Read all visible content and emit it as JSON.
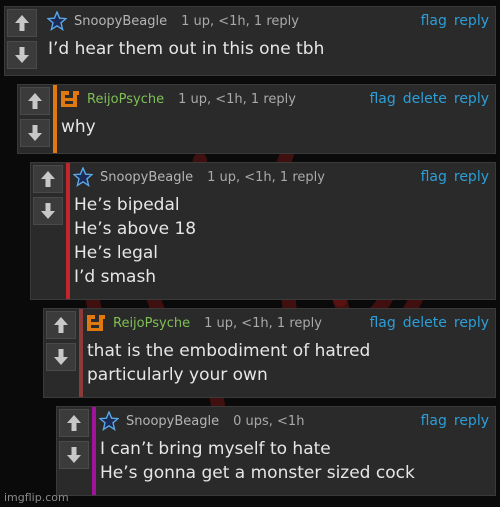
{
  "colors": {
    "link": "#2b9fd8",
    "sigil": "#7a1616",
    "accent_orange": "#e07a10",
    "accent_red": "#c0262c",
    "accent_dark_red": "#8c3a3a",
    "accent_magenta": "#a0149a"
  },
  "comments": [
    {
      "username": "SnoopyBeagle",
      "avatar_icon": "star-icon",
      "meta": "1 up, <1h, 1 reply",
      "actions": [
        "flag",
        "reply"
      ],
      "lines": [
        "I’d hear them out in this one tbh"
      ]
    },
    {
      "username": "ReijoPsyche",
      "avatar_icon": "pixel-logo-icon",
      "meta": "1 up, <1h, 1 reply",
      "actions": [
        "flag",
        "delete",
        "reply"
      ],
      "lines": [
        "why"
      ]
    },
    {
      "username": "SnoopyBeagle",
      "avatar_icon": "star-icon",
      "meta": "1 up, <1h, 1 reply",
      "actions": [
        "flag",
        "reply"
      ],
      "lines": [
        "He’s bipedal",
        "He’s above 18",
        "He’s legal",
        "I’d smash"
      ]
    },
    {
      "username": "ReijoPsyche",
      "avatar_icon": "pixel-logo-icon",
      "meta": "1 up, <1h, 1 reply",
      "actions": [
        "flag",
        "delete",
        "reply"
      ],
      "lines": [
        "that is the embodiment of hatred",
        "particularly your own"
      ]
    },
    {
      "username": "SnoopyBeagle",
      "avatar_icon": "star-icon",
      "meta": "0 ups, <1h",
      "actions": [
        "flag",
        "reply"
      ],
      "lines": [
        "I can’t bring myself to hate",
        "He’s gonna get a monster sized cock"
      ]
    }
  ],
  "watermark": "imgflip.com"
}
